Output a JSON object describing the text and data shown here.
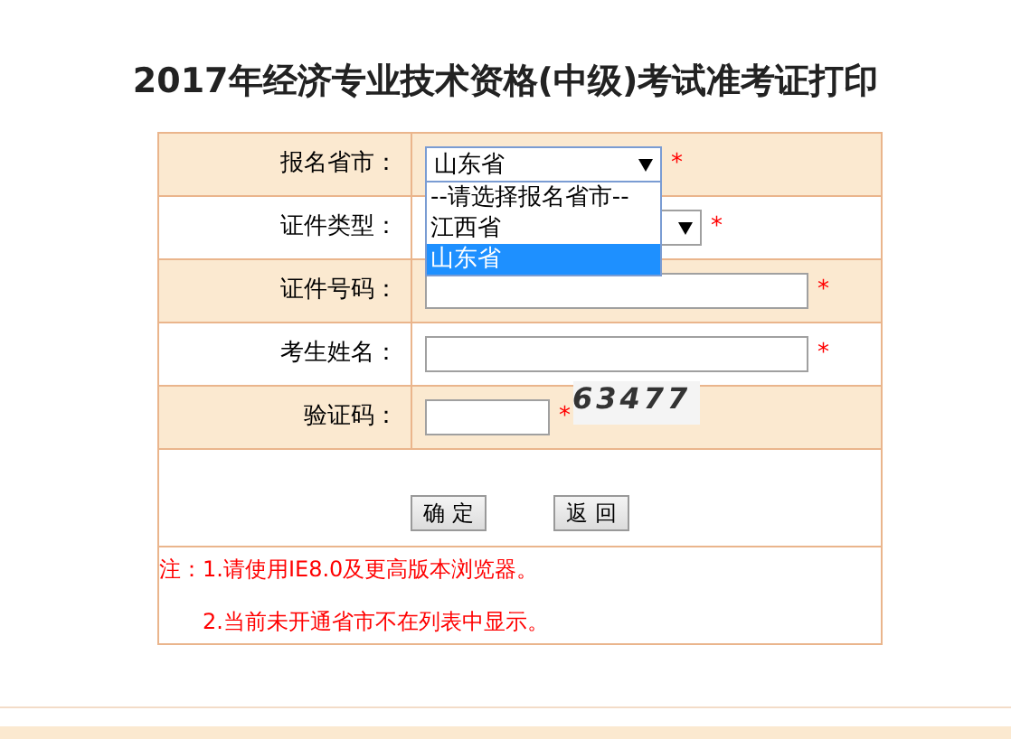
{
  "title": "2017年经济专业技术资格(中级)考试准考证打印",
  "rows": [
    {
      "kind": "select",
      "label": "报名省市：",
      "value": "山东省",
      "required_mark": "*",
      "options": [
        {
          "label": "--请选择报名省市--",
          "selected": false
        },
        {
          "label": "江西省",
          "selected": false
        },
        {
          "label": "山东省",
          "selected": true
        }
      ]
    },
    {
      "kind": "select",
      "label": "证件类型：",
      "required_mark": "*"
    },
    {
      "kind": "input",
      "label": "证件号码：",
      "required_mark": "*"
    },
    {
      "kind": "input",
      "label": "考生姓名：",
      "required_mark": "*"
    },
    {
      "kind": "captcha",
      "label": "验证码：",
      "required_mark": "*",
      "captcha": "63477"
    }
  ],
  "buttons": [
    "确 定",
    "返 回"
  ],
  "notes": [
    "注：1.请使用IE8.0及更高版本浏览器。",
    "2.当前未开通省市不在列表中显示。"
  ]
}
